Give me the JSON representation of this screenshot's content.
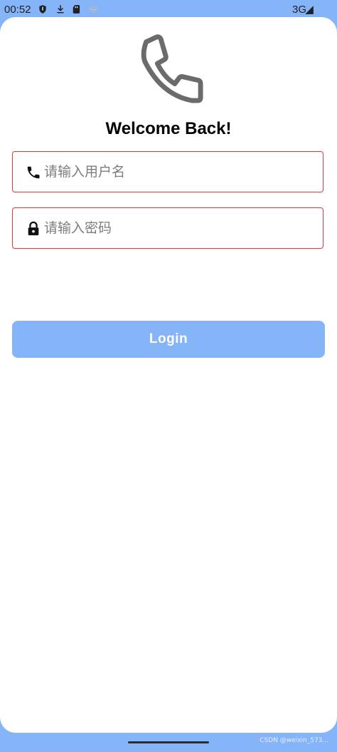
{
  "status_bar": {
    "time": "00:52",
    "network": "3G",
    "icons": [
      "shield-icon",
      "download-icon",
      "sd-card-icon",
      "wifi-icon",
      "signal-icon"
    ]
  },
  "logo": {
    "icon": "phone-icon"
  },
  "title": "Welcome Back!",
  "username_field": {
    "placeholder": "请输入用户名",
    "value": "",
    "icon": "phone-icon"
  },
  "password_field": {
    "placeholder": "请输入密码",
    "value": "",
    "icon": "lock-icon"
  },
  "login_button": {
    "label": "Login"
  },
  "watermark": "CSDN @weixin_573..."
}
